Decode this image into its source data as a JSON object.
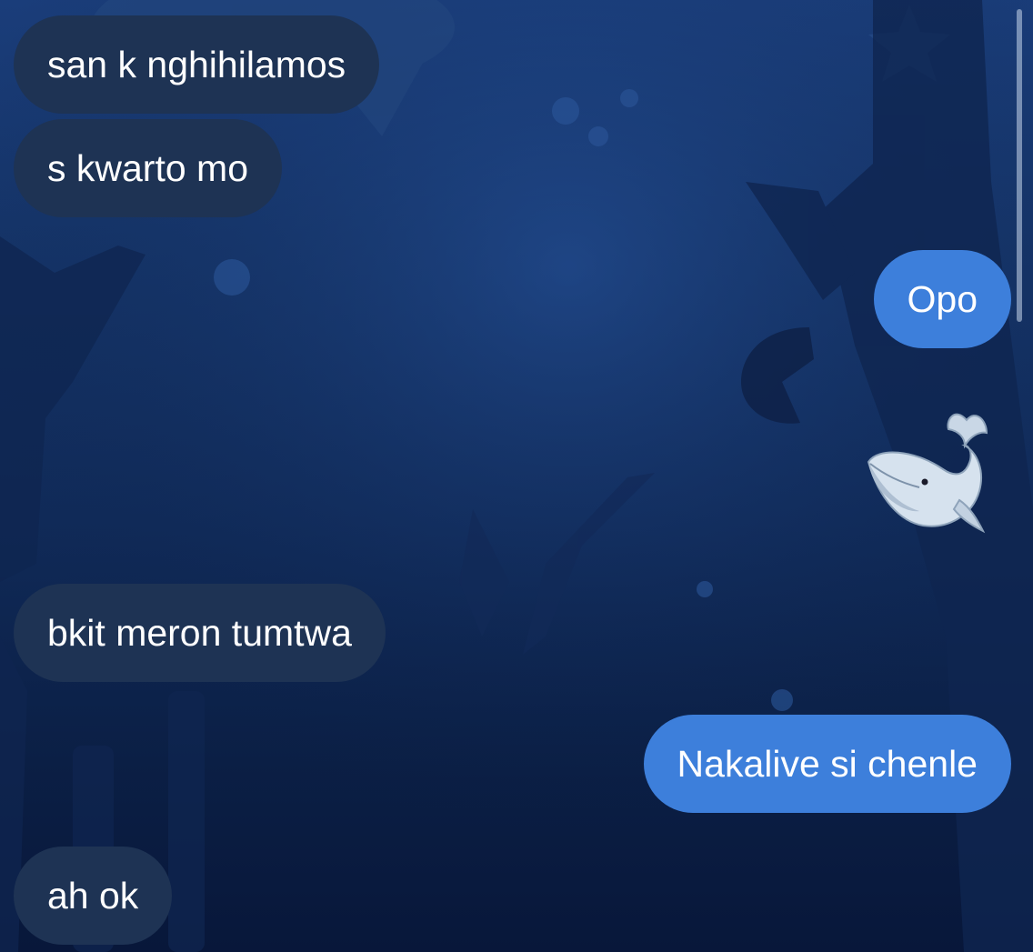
{
  "messages": [
    {
      "side": "incoming",
      "text": "san k nghihilamos"
    },
    {
      "side": "incoming",
      "text": "s kwarto mo"
    },
    {
      "side": "outgoing",
      "text": "Opo"
    },
    {
      "side": "outgoing",
      "sticker": "whale-emoji"
    },
    {
      "side": "incoming",
      "text": "bkit meron tumtwa"
    },
    {
      "side": "outgoing",
      "text": "Nakalive si chenle"
    },
    {
      "side": "incoming",
      "text": "ah ok"
    }
  ],
  "theme": {
    "background": "deep-ocean",
    "incoming_bubble_color": "#1e3354",
    "outgoing_bubble_color": "#3d7fdb",
    "text_color": "#ffffff"
  }
}
